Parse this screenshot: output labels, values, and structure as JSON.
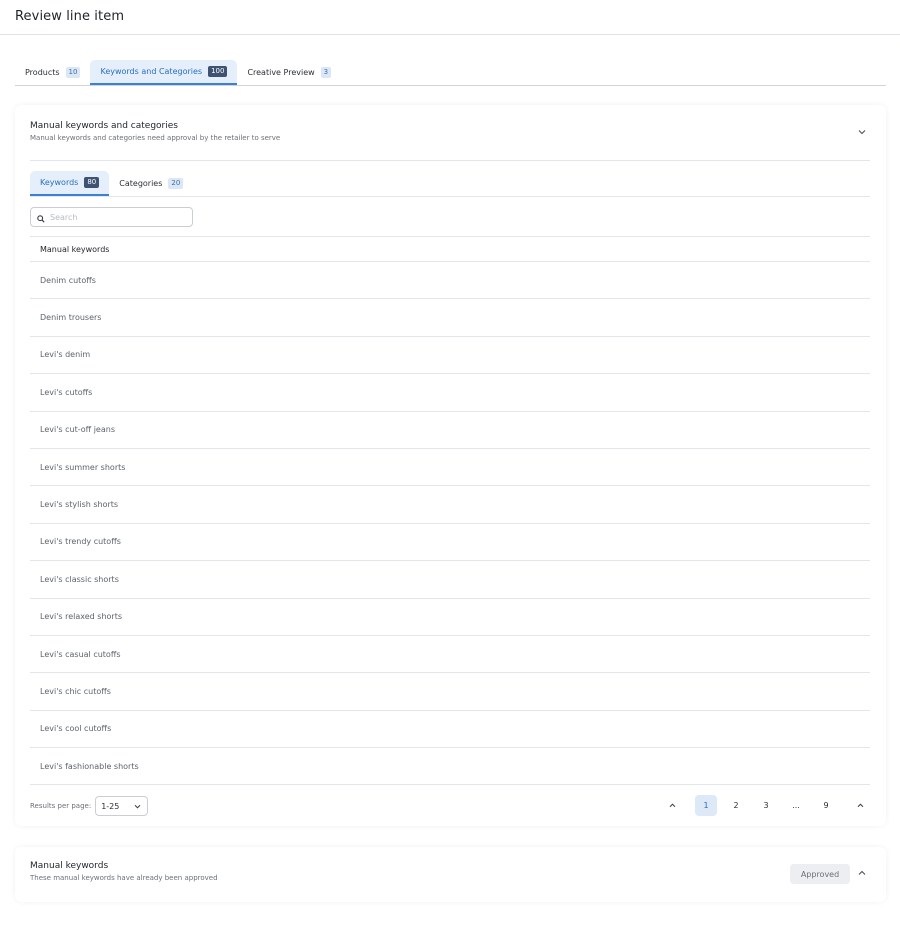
{
  "page": {
    "title": "Review line item"
  },
  "top_tabs": [
    {
      "label": "Products",
      "count": "10"
    },
    {
      "label": "Keywords and Categories",
      "count": "100"
    },
    {
      "label": "Creative Preview",
      "count": "3"
    }
  ],
  "manual_section": {
    "title": "Manual keywords and categories",
    "subtitle": "Manual keywords and categories need approval by the retailer to serve",
    "tabs": [
      {
        "label": "Keywords",
        "count": "80"
      },
      {
        "label": "Categories",
        "count": "20"
      }
    ],
    "search_placeholder": "Search",
    "table_header": "Manual keywords",
    "rows": [
      "Denim cutoffs",
      "Denim trousers",
      "Levi's denim",
      "Levi's cutoffs",
      "Levi's cut-off jeans",
      "Levi's summer shorts",
      "Levi's stylish shorts",
      "Levi's trendy cutoffs",
      "Levi's classic shorts",
      "Levi's relaxed shorts",
      "Levi's casual cutoffs",
      "Levi's chic cutoffs",
      "Levi's cool cutoffs",
      "Levi's fashionable shorts"
    ]
  },
  "pagination": {
    "results_label": "Results per page:",
    "results_value": "1-25",
    "pages": [
      "1",
      "2",
      "3",
      "...",
      "9"
    ]
  },
  "approved_section": {
    "title": "Manual keywords",
    "subtitle": "These manual keywords have already been approved",
    "status_label": "Approved"
  },
  "icons": {
    "expand": "chevron-down-icon",
    "collapse": "chevron-up-icon",
    "search": "search-icon"
  },
  "colors": {
    "accent": "#2a6ebf",
    "active_tab_bg": "#e4effb",
    "badge_dark": "#3e5372"
  }
}
